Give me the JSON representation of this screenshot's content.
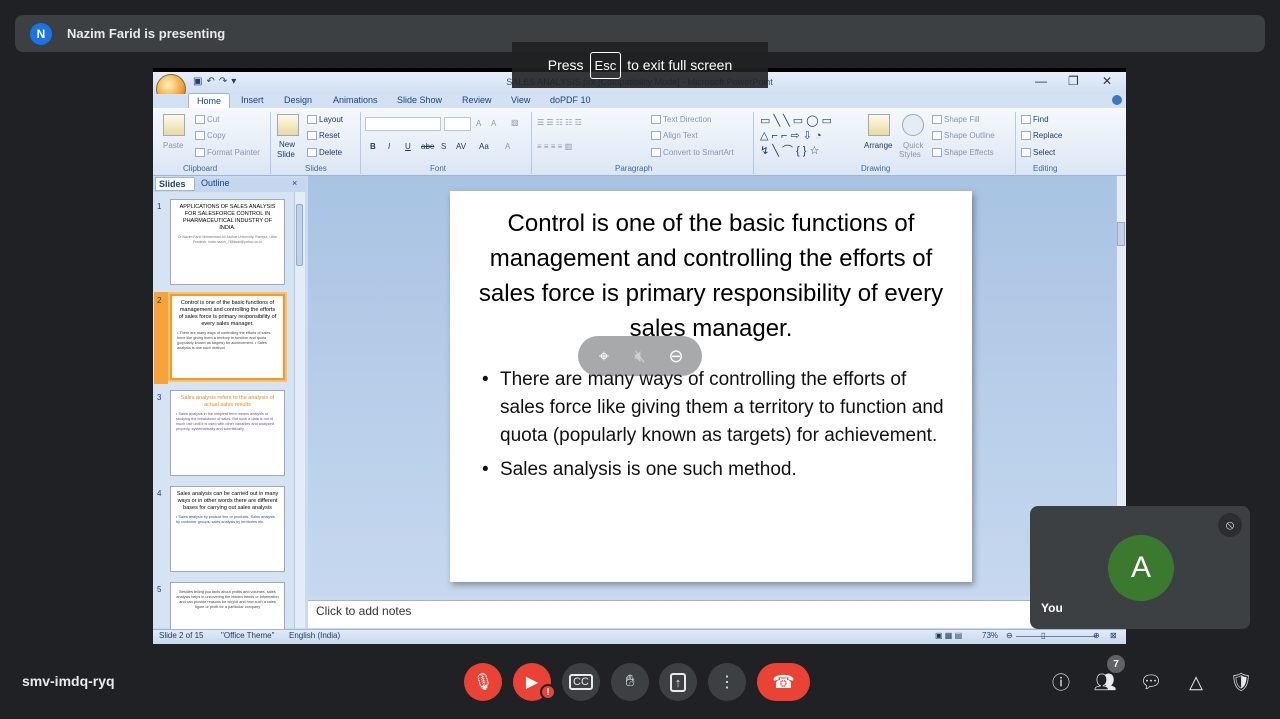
{
  "meet": {
    "presenter_initial": "N",
    "presenter_text": "Nazim Farid is presenting",
    "esc_press": "Press",
    "esc_key": "Esc",
    "esc_suffix": "to exit full screen",
    "meeting_code": "smv-imdq-ryq",
    "self_initial": "A",
    "self_name": "You",
    "people_count": "7",
    "alert_glyph": "!",
    "colors": {
      "leave": "#ea4335",
      "presenter_avatar": "#1a73e8",
      "self_avatar": "#3b7a2e"
    }
  },
  "ppt": {
    "title": "SALES ANALYSIS.ppt [Compatibility Mode] - Microsoft PowerPoint",
    "tabs": [
      "Home",
      "Insert",
      "Design",
      "Animations",
      "Slide Show",
      "Review",
      "View",
      "doPDF 10"
    ],
    "clipboard": {
      "cut": "Cut",
      "copy": "Copy",
      "format_painter": "Format Painter",
      "paste": "Paste",
      "label": "Clipboard"
    },
    "slides_group": {
      "layout": "Layout",
      "reset": "Reset",
      "delete": "Delete",
      "new_slide": "New",
      "new_slide2": "Slide",
      "label": "Slides"
    },
    "font_group": {
      "label": "Font",
      "grow": "A",
      "shrink": "A",
      "bold": "B",
      "italic": "I",
      "underline": "U",
      "strike": "abe",
      "shadow": "S",
      "spacing": "AV",
      "case": "Aa"
    },
    "paragraph_group": {
      "text_direction": "Text Direction",
      "align_text": "Align Text",
      "smartart": "Convert to SmartArt",
      "label": "Paragraph"
    },
    "drawing_group": {
      "arrange": "Arrange",
      "quick": "Quick",
      "styles": "Styles",
      "shape_fill": "Shape Fill",
      "shape_outline": "Shape Outline",
      "shape_effects": "Shape Effects",
      "label": "Drawing"
    },
    "editing_group": {
      "find": "Find",
      "replace": "Replace",
      "select": "Select",
      "label": "Editing"
    },
    "pane_tabs": {
      "slides": "Slides",
      "outline": "Outline"
    },
    "thumbnails": [
      {
        "num": "1",
        "title": "APPLICATIONS OF SALES ANALYSIS FOR SALESFORCE CONTROL IN PHARMACEUTICAL INDUSTRY OF INDIA.",
        "body": "Dr.Nazim Farid Mohammad Ali Jauhar University, Rampur, Uttar Pradesh, India nazim_786farid@yahoo.co.in"
      },
      {
        "num": "2",
        "title": "Control is one of the basic functions of management and controlling the efforts of sales force is primary responsibility of every sales manager.",
        "body": "• There are many ways of controlling the efforts of sales force like giving them a territory to function and quota (popularly known as targets) for achievement. • Sales analysis is one such method."
      },
      {
        "num": "3",
        "title": "Sales analysis refers to the analysis of actual sales results",
        "body": "• Sales analysis in the simplest term means analysis or studying the breakdown of sales. But such a data is not of much use until it is used with other variables and analyzed properly, systematically and scientifically."
      },
      {
        "num": "4",
        "title": "Sales analysis can be carried out in many ways or in other words there are different bases for carrying out sales analysis",
        "body": "• Sales analysis by product line or products, Sales analysis by customer groups, sales analysis by territories etc."
      },
      {
        "num": "5",
        "title": "",
        "body": "Besides telling you facts about profits and volumes, sales analysis helps in uncovering the hidden trends or information and can provide reasons for why/di and how such a sales figure or profit for a particular company"
      }
    ],
    "slide": {
      "title": "Control is one of the basic functions of management and controlling the efforts of sales force is primary responsibility of every sales manager.",
      "bullets": [
        "There are many ways of controlling the efforts of sales force like giving them a territory to function and quota (popularly known as targets) for achievement.",
        "Sales analysis is one such method."
      ]
    },
    "notes_placeholder": "Click to add notes",
    "status": {
      "slide": "Slide 2 of 15",
      "theme": "\"Office Theme\"",
      "language": "English (India)",
      "zoom": "73%"
    }
  }
}
